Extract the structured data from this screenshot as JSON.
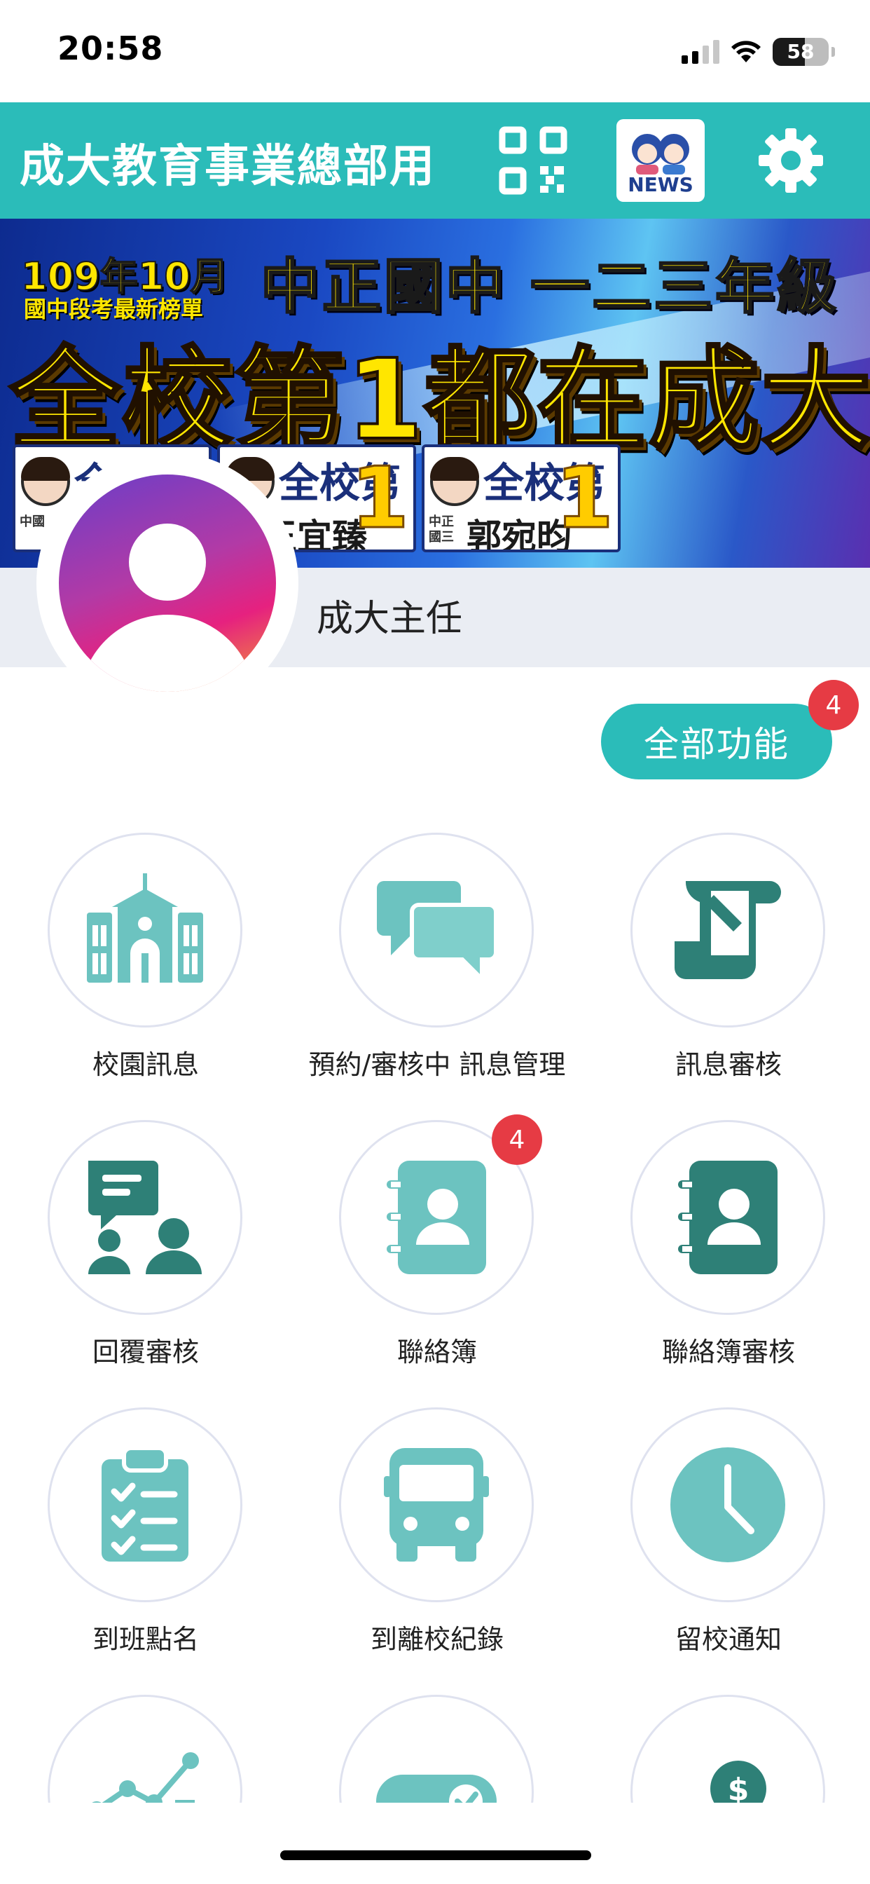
{
  "status_bar": {
    "time": "20:58",
    "battery": "58"
  },
  "header": {
    "title": "成大教育事業總部用"
  },
  "banner": {
    "date": "109年10月",
    "subtitle": "國中段考最新榜單",
    "school": "中正國中 一二三年級",
    "headline": "全校第1都在成大",
    "cards": [
      {
        "tag": "全校第",
        "name": "",
        "grade": "中國"
      },
      {
        "tag": "全校第",
        "name": "王宜臻",
        "grade": ""
      },
      {
        "tag": "全校第",
        "name": "郭宛昀",
        "grade": "中正國三"
      }
    ],
    "number_one": "1",
    "colors": {
      "accent": "#ffe600",
      "background": "#1a48c2"
    }
  },
  "profile": {
    "name": "成大主任"
  },
  "all_functions": {
    "label": "全部功能",
    "badge": "4"
  },
  "theme": {
    "primary": "#2bbcb9",
    "icon_light": "#6cc3c0",
    "icon_dark": "#2e8077",
    "badge": "#e63b44"
  },
  "grid": [
    {
      "label": "校園訊息",
      "icon": "school-building-icon"
    },
    {
      "label": "預約/審核中 訊息管理",
      "icon": "chat-bubbles-icon"
    },
    {
      "label": "訊息審核",
      "icon": "message-review-icon"
    },
    {
      "label": "回覆審核",
      "icon": "reply-review-icon"
    },
    {
      "label": "聯絡簿",
      "icon": "contact-book-icon",
      "badge": "4"
    },
    {
      "label": "聯絡簿審核",
      "icon": "contact-book-review-icon"
    },
    {
      "label": "到班點名",
      "icon": "clipboard-check-icon"
    },
    {
      "label": "到離校紀錄",
      "icon": "bus-icon"
    },
    {
      "label": "留校通知",
      "icon": "clock-icon"
    },
    {
      "label": "",
      "icon": "chart-icon"
    },
    {
      "label": "",
      "icon": "ticket-check-icon"
    },
    {
      "label": "",
      "icon": "payment-icon"
    }
  ]
}
